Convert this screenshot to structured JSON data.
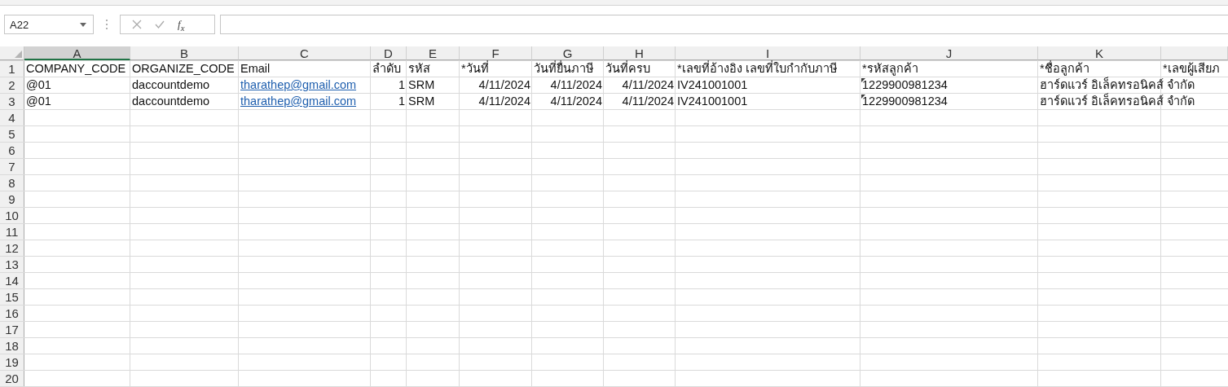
{
  "formula_bar": {
    "name_box": "A22",
    "function_label": "f$_{x}$"
  },
  "sheet": {
    "columns": [
      {
        "label": "A",
        "selected": true
      },
      {
        "label": "B",
        "selected": false
      },
      {
        "label": "C",
        "selected": false
      },
      {
        "label": "D",
        "selected": false
      },
      {
        "label": "E",
        "selected": false
      },
      {
        "label": "F",
        "selected": false
      },
      {
        "label": "G",
        "selected": false
      },
      {
        "label": "H",
        "selected": false
      },
      {
        "label": "I",
        "selected": false
      },
      {
        "label": "J",
        "selected": false
      },
      {
        "label": "K",
        "selected": false
      },
      {
        "selected": false
      }
    ],
    "rows": [
      {
        "number": "1",
        "selected": false,
        "cells": [
          {
            "text": "COMPANY_CODE",
            "kind": "text"
          },
          {
            "text": "ORGANIZE_CODE",
            "kind": "text"
          },
          {
            "text": "Email",
            "kind": "text"
          },
          {
            "text": "ลำดับ",
            "kind": "text"
          },
          {
            "text": "รหัส",
            "kind": "text"
          },
          {
            "text": "*วันที่",
            "kind": "text"
          },
          {
            "text": "วันที่ยื่นภาษี",
            "kind": "text"
          },
          {
            "text": "วันที่ครบ",
            "kind": "text"
          },
          {
            "text": "*เลขที่อ้างอิง  เลขที่ใบกำกับภาษี",
            "kind": "text"
          },
          {
            "text": "*รหัสลูกค้า",
            "kind": "text"
          },
          {
            "text": "*ชื่อลูกค้า",
            "kind": "text"
          },
          {
            "text": "*เลขผู้เสียภ",
            "kind": "text"
          }
        ]
      },
      {
        "number": "2",
        "selected": false,
        "cells": [
          {
            "text": "@01",
            "kind": "text"
          },
          {
            "text": "daccountdemo",
            "kind": "text"
          },
          {
            "text": "tharathep@gmail.com",
            "kind": "link"
          },
          {
            "text": "1",
            "kind": "number"
          },
          {
            "text": "SRM",
            "kind": "text"
          },
          {
            "text": "4/11/2024",
            "kind": "number"
          },
          {
            "text": "4/11/2024",
            "kind": "number"
          },
          {
            "text": "4/11/2024",
            "kind": "number"
          },
          {
            "text": "IV241001001",
            "kind": "text"
          },
          {
            "text": "1229900981234",
            "kind": "flagged"
          },
          {
            "text": "ฮาร์ดแวร์ อิเล็คทรอนิคส์ จำกัด",
            "kind": "text"
          }
        ]
      },
      {
        "number": "3",
        "selected": false,
        "cells": [
          {
            "text": "@01",
            "kind": "text"
          },
          {
            "text": "daccountdemo",
            "kind": "text"
          },
          {
            "text": "tharathep@gmail.com",
            "kind": "link"
          },
          {
            "text": "1",
            "kind": "number"
          },
          {
            "text": "SRM",
            "kind": "text"
          },
          {
            "text": "4/11/2024",
            "kind": "number"
          },
          {
            "text": "4/11/2024",
            "kind": "number"
          },
          {
            "text": "4/11/2024",
            "kind": "number"
          },
          {
            "text": "IV241001001",
            "kind": "text"
          },
          {
            "text": "1229900981234",
            "kind": "flagged"
          },
          {
            "text": "ฮาร์ดแวร์ อิเล็คทรอนิคส์ จำกัด",
            "kind": "text"
          }
        ]
      },
      {
        "number": "4",
        "selected": false,
        "cells": []
      },
      {
        "number": "5",
        "selected": false,
        "cells": []
      },
      {
        "number": "6",
        "selected": false,
        "cells": []
      },
      {
        "number": "7",
        "selected": false,
        "cells": []
      },
      {
        "number": "8",
        "selected": false,
        "cells": []
      },
      {
        "number": "9",
        "selected": false,
        "cells": []
      },
      {
        "number": "10",
        "selected": false,
        "cells": []
      },
      {
        "number": "11",
        "selected": false,
        "cells": []
      },
      {
        "number": "12",
        "selected": false,
        "cells": []
      },
      {
        "number": "13",
        "selected": false,
        "cells": []
      },
      {
        "number": "14",
        "selected": false,
        "cells": []
      },
      {
        "number": "15",
        "selected": false,
        "cells": []
      },
      {
        "number": "16",
        "selected": false,
        "cells": []
      },
      {
        "number": "17",
        "selected": false,
        "cells": []
      },
      {
        "number": "18",
        "selected": false,
        "cells": []
      },
      {
        "number": "19",
        "selected": false,
        "cells": []
      },
      {
        "number": "20",
        "selected": false,
        "cells": []
      }
    ]
  }
}
